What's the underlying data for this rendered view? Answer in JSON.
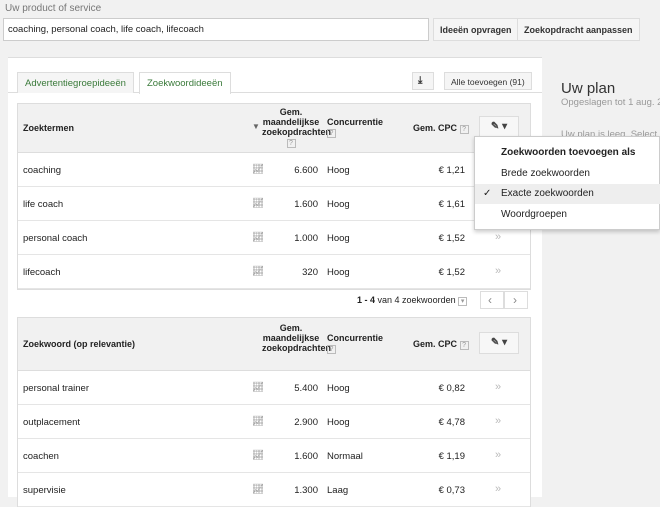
{
  "search": {
    "label": "Uw product of service",
    "value": "coaching, personal coach, life coach, lifecoach",
    "get_ideas": "Ideeën opvragen",
    "modify": "Zoekopdracht aanpassen"
  },
  "tabs": [
    {
      "label": "Advertentiegroepideeën"
    },
    {
      "label": "Zoekwoordideeën"
    }
  ],
  "add_all": "Alle toevoegen (91)",
  "headers": {
    "searches": "Gem. maandelijkse zoekopdrachten",
    "competition": "Concurrentie",
    "cpc": "Gem. CPC",
    "help": "?"
  },
  "table1": {
    "title": "Zoektermen",
    "rows": [
      {
        "term": "coaching",
        "searches": "6.600",
        "competition": "Hoog",
        "cpc": "€ 1,21"
      },
      {
        "term": "life coach",
        "searches": "1.600",
        "competition": "Hoog",
        "cpc": "€ 1,61"
      },
      {
        "term": "personal coach",
        "searches": "1.000",
        "competition": "Hoog",
        "cpc": "€ 1,52"
      },
      {
        "term": "lifecoach",
        "searches": "320",
        "competition": "Hoog",
        "cpc": "€ 1,52"
      }
    ]
  },
  "pagination": {
    "range": "1 - 4",
    "text": "van 4 zoekwoorden"
  },
  "table2": {
    "title": "Zoekwoord (op relevantie)",
    "rows": [
      {
        "term": "personal trainer",
        "searches": "5.400",
        "competition": "Hoog",
        "cpc": "€ 0,82"
      },
      {
        "term": "outplacement",
        "searches": "2.900",
        "competition": "Hoog",
        "cpc": "€ 4,78"
      },
      {
        "term": "coachen",
        "searches": "1.600",
        "competition": "Normaal",
        "cpc": "€ 1,19"
      },
      {
        "term": "supervisie",
        "searches": "1.300",
        "competition": "Laag",
        "cpc": "€ 0,73"
      }
    ]
  },
  "plan": {
    "title": "Uw plan",
    "saved": "Opgeslagen tot 1 aug. 2",
    "empty": "Uw plan is leeg. Select"
  },
  "menu": {
    "title": "Zoekwoorden toevoegen als",
    "items": [
      "Brede zoekwoorden",
      "Exacte zoekwoorden",
      "Woordgroepen"
    ],
    "checked": "✓"
  }
}
